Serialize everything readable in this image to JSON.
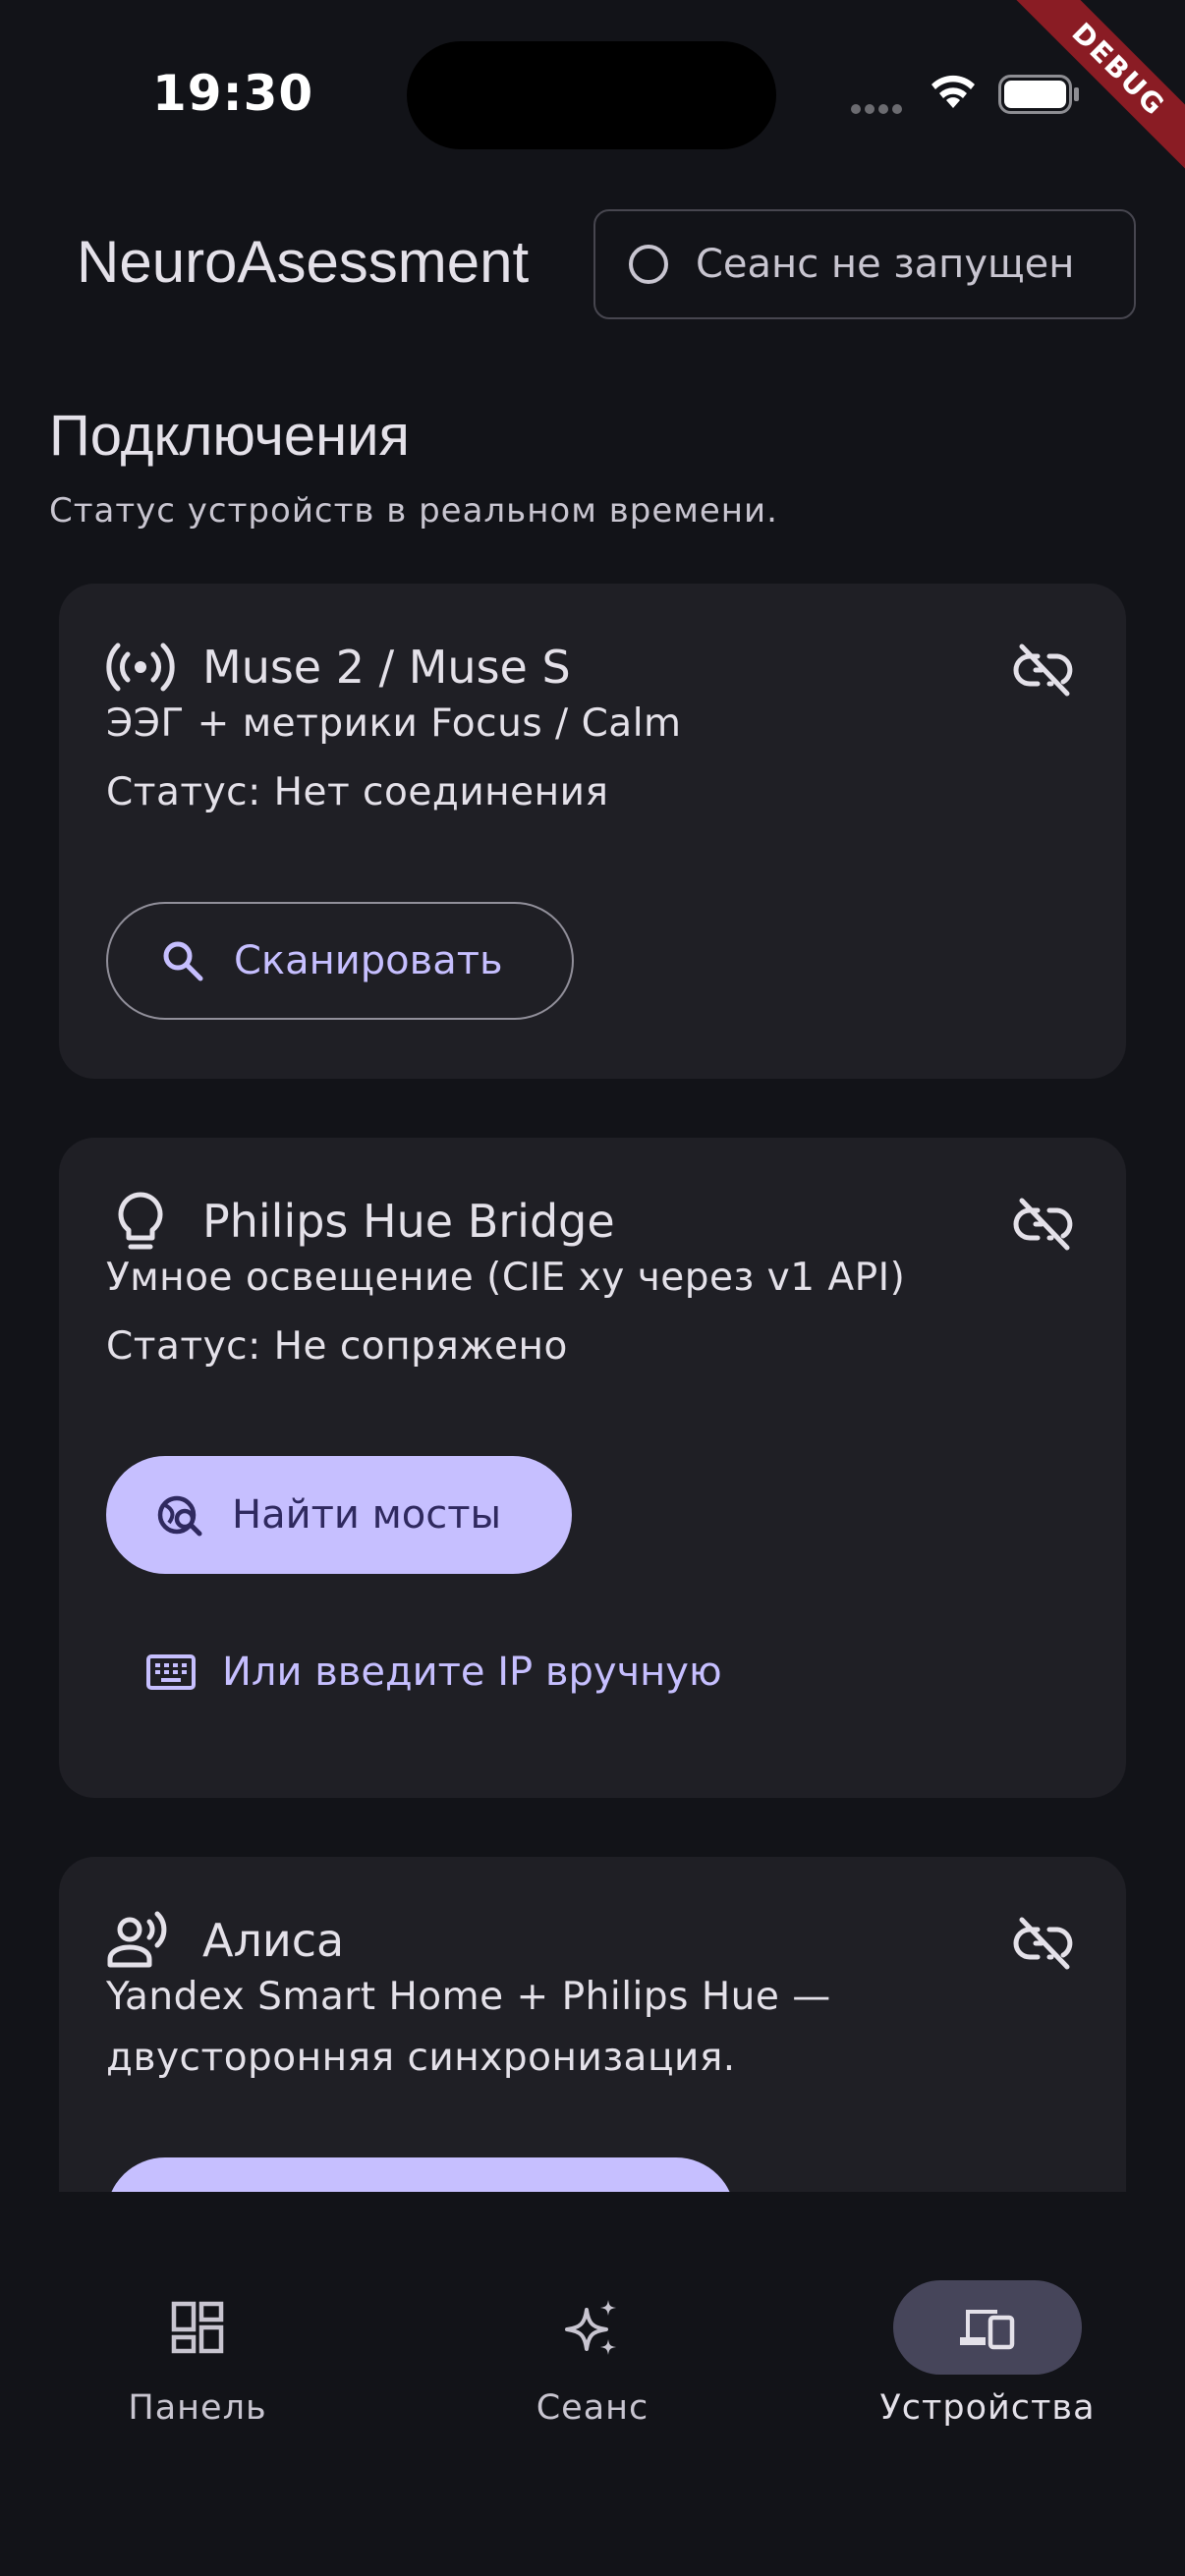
{
  "status_bar": {
    "time": "19:30",
    "debug_label": "DEBUG"
  },
  "app_bar": {
    "title": "NeuroAsessment",
    "session_chip": "Сеанс не запущен"
  },
  "section": {
    "title": "Подключения",
    "subtitle": "Статус устройств в реальном времени."
  },
  "cards": [
    {
      "icon": "sensors-icon",
      "title": "Muse 2 / Muse S",
      "description": "ЭЭГ + метрики Focus / Calm",
      "status": "Статус: Нет соединения",
      "button": "Сканировать"
    },
    {
      "icon": "lightbulb-icon",
      "title": "Philips Hue Bridge",
      "description": "Умное освещение (CIE xy через v1 API)",
      "status": "Статус: Не сопряжено",
      "button": "Найти мосты",
      "text_button": "Или введите IP вручную"
    },
    {
      "icon": "voice-person-icon",
      "title": "Алиса",
      "description_line1": "Yandex Smart Home + Philips Hue —",
      "description_line2": "двусторонняя синхронизация."
    }
  ],
  "nav": {
    "items": [
      {
        "label": "Панель",
        "icon": "dashboard-icon",
        "active": false
      },
      {
        "label": "Сеанс",
        "icon": "sparkle-icon",
        "active": false
      },
      {
        "label": "Устройства",
        "icon": "devices-icon",
        "active": true
      }
    ]
  },
  "colors": {
    "background": "#121318",
    "card": "#1f1f25",
    "accent": "#c6bfff",
    "on_accent": "#2f295f",
    "active_pill": "#46455a"
  }
}
